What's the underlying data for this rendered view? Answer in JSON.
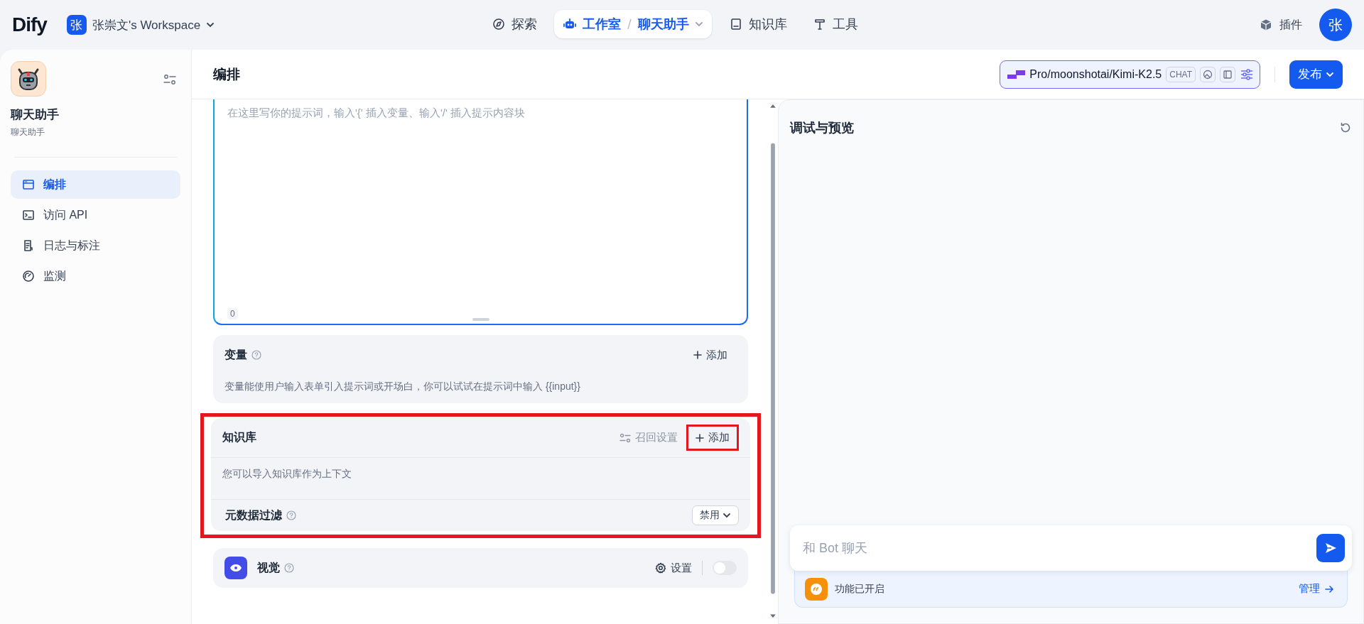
{
  "top_nav": {
    "logo": "Dify",
    "workspace": {
      "avatar": "张",
      "name": "张崇文's Workspace"
    },
    "tabs": [
      {
        "label": "探索",
        "selected": false
      },
      {
        "label": "工作室",
        "selected": true,
        "app": "聊天助手"
      },
      {
        "label": "知识库",
        "selected": false
      },
      {
        "label": "工具",
        "selected": false
      }
    ],
    "plugins": "插件",
    "user_avatar": "张"
  },
  "sidebar": {
    "app_name": "聊天助手",
    "app_type": "聊天助手",
    "items": [
      {
        "label": "编排",
        "selected": true
      },
      {
        "label": "访问 API",
        "selected": false
      },
      {
        "label": "日志与标注",
        "selected": false
      },
      {
        "label": "监测",
        "selected": false
      }
    ]
  },
  "header": {
    "title": "编排",
    "model": {
      "name": "Pro/moonshotai/Kimi-K2.5",
      "mode": "CHAT"
    },
    "publish": "发布"
  },
  "prompt": {
    "placeholder": "在这里写你的提示词，输入'{' 插入变量、输入'/' 插入提示内容块",
    "count": "0"
  },
  "variables": {
    "title": "变量",
    "add": "添加",
    "description": "变量能使用户输入表单引入提示词或开场白，你可以试试在提示词中输入 {{input}}"
  },
  "knowledge": {
    "title": "知识库",
    "highlighted": true,
    "retrieval_settings": {
      "label": "召回设置",
      "disabled": true
    },
    "add": {
      "label": "添加",
      "highlighted": true
    },
    "description": "您可以导入知识库作为上下文",
    "metadata_filter": {
      "label": "元数据过滤",
      "value": "禁用"
    }
  },
  "vision": {
    "title": "视觉",
    "settings": "设置",
    "on": false
  },
  "debug": {
    "title": "调试与预览",
    "chat_input": {
      "placeholder": "和 Bot 聊天"
    },
    "features": {
      "label": "功能已开启",
      "manage": "管理"
    }
  }
}
